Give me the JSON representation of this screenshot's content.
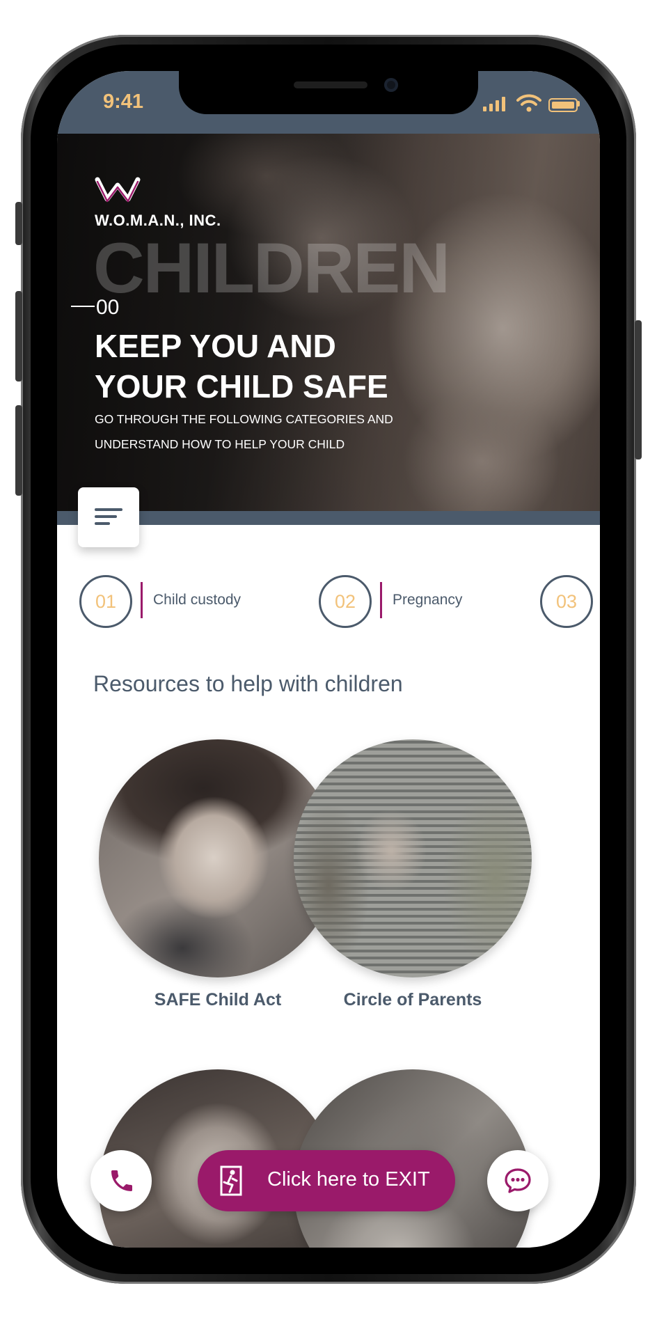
{
  "status_bar": {
    "time": "9:41"
  },
  "hero": {
    "org_name": "W.O.M.A.N., INC.",
    "background_word": "CHILDREN",
    "number": "00",
    "headline_line1": "KEEP YOU AND",
    "headline_line2": "YOUR CHILD SAFE",
    "subtitle_line1": "GO THROUGH THE FOLLOWING CATEGORIES AND",
    "subtitle_line2": "UNDERSTAND HOW TO HELP YOUR CHILD"
  },
  "categories": [
    {
      "number": "01",
      "label": "Child custody"
    },
    {
      "number": "02",
      "label": "Pregnancy"
    },
    {
      "number": "03",
      "label": ""
    }
  ],
  "resources": {
    "title": "Resources to help with children",
    "items": [
      {
        "label": "SAFE Child Act"
      },
      {
        "label": "Circle of Parents"
      }
    ]
  },
  "bottom_bar": {
    "exit_label": "Click here to EXIT",
    "phone_icon": "phone-icon",
    "chat_icon": "chat-icon"
  },
  "colors": {
    "brand": "#9a1a6a",
    "slate": "#4b5a6b",
    "accent": "#f2c27a"
  }
}
